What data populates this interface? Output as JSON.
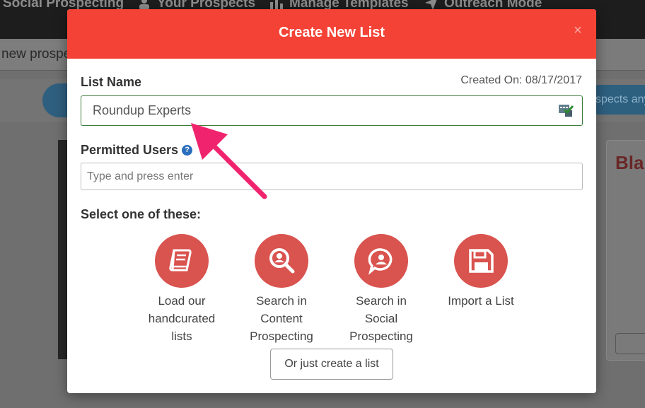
{
  "nav": {
    "items": [
      "Social Prospecting",
      "Your Prospects",
      "Manage Templates",
      "Outreach Mode"
    ],
    "search_value": "new prospe"
  },
  "background": {
    "pill_text": "spects any",
    "card_title": "Bla"
  },
  "modal": {
    "title": "Create New List",
    "close_label": "×",
    "list_name_label": "List Name",
    "created_on": "Created On: 08/17/2017",
    "list_name_value": "Roundup Experts",
    "permitted_users_label": "Permitted Users",
    "help_label": "?",
    "users_placeholder": "Type and press enter",
    "select_label": "Select one of these:",
    "options": [
      {
        "icon": "book-icon",
        "label": "Load our handcurated lists"
      },
      {
        "icon": "search-user-icon",
        "label": "Search in Content Prospecting"
      },
      {
        "icon": "chat-user-icon",
        "label": "Search in Social Prospecting"
      },
      {
        "icon": "floppy-disk-icon",
        "label": "Import a List"
      }
    ],
    "create_button": "Or just create a list"
  },
  "colors": {
    "header": "#f44336",
    "option_circle": "#d9534f",
    "arrow": "#f0246e",
    "input_border_valid": "#3e7d3e"
  }
}
